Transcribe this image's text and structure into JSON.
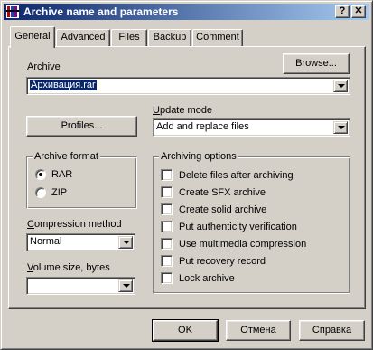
{
  "window": {
    "title": "Archive name and parameters",
    "help_button": "?",
    "close_button": "✕"
  },
  "tabs": [
    {
      "label": "General",
      "active": true
    },
    {
      "label": "Advanced",
      "active": false
    },
    {
      "label": "Files",
      "active": false
    },
    {
      "label": "Backup",
      "active": false
    },
    {
      "label": "Comment",
      "active": false
    }
  ],
  "archive": {
    "label": "Archive",
    "value": "Архивация.rar",
    "browse_label": "Browse..."
  },
  "profiles_label": "Profiles...",
  "update_mode": {
    "label": "Update mode",
    "value": "Add and replace files"
  },
  "archive_format": {
    "title": "Archive format",
    "options": [
      {
        "label": "RAR",
        "selected": true
      },
      {
        "label": "ZIP",
        "selected": false
      }
    ]
  },
  "compression": {
    "label": "Compression method",
    "value": "Normal"
  },
  "volume": {
    "label": "Volume size, bytes",
    "value": ""
  },
  "archiving_options": {
    "title": "Archiving options",
    "items": [
      {
        "label": "Delete files after archiving",
        "checked": false
      },
      {
        "label": "Create SFX archive",
        "checked": false
      },
      {
        "label": "Create solid archive",
        "checked": false
      },
      {
        "label": "Put authenticity verification",
        "checked": false
      },
      {
        "label": "Use multimedia compression",
        "checked": false
      },
      {
        "label": "Put recovery record",
        "checked": false
      },
      {
        "label": "Lock archive",
        "checked": false
      }
    ]
  },
  "footer": {
    "ok_label": "OK",
    "cancel_label": "Отмена",
    "help_label": "Справка"
  },
  "colors": {
    "titlebar_start": "#0a246a",
    "titlebar_end": "#a6caf0",
    "face": "#d4d0c8",
    "selection": "#0a246a"
  }
}
